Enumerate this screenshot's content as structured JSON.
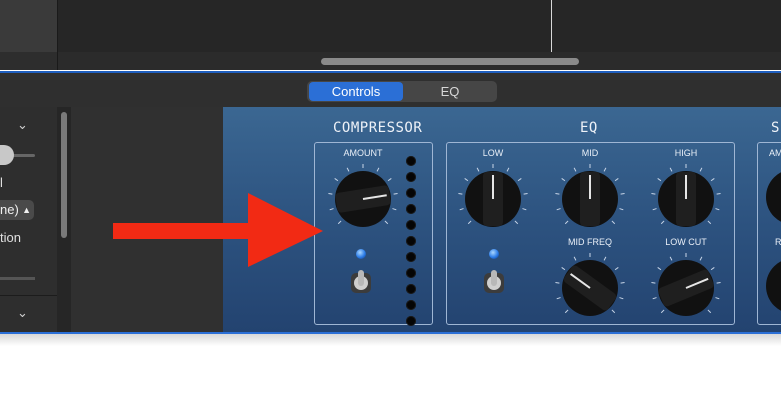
{
  "tabs": {
    "controls": "Controls",
    "eq": "EQ"
  },
  "inspector": {
    "letter": "l",
    "select_value": "ne)",
    "label": "tion"
  },
  "plugin": {
    "compressor": {
      "title": "COMPRESSOR",
      "amount_label": "AMOUNT"
    },
    "eq": {
      "title": "EQ",
      "low_label": "LOW",
      "mid_label": "MID",
      "high_label": "HIGH",
      "mid_freq_label": "MID FREQ",
      "low_cut_label": "LOW CUT"
    },
    "next_section": {
      "title": "S",
      "label_top": "AM",
      "label_bottom": "R"
    }
  },
  "knobs": {
    "compressor_amount": 0.8,
    "eq_low": 0.5,
    "eq_mid": 0.5,
    "eq_high": 0.5,
    "eq_mid_freq": 0.3,
    "eq_low_cut": 0.75
  },
  "colors": {
    "accent": "#2b6fd6",
    "panel": "#2d5380",
    "arrow": "#f22a14"
  }
}
